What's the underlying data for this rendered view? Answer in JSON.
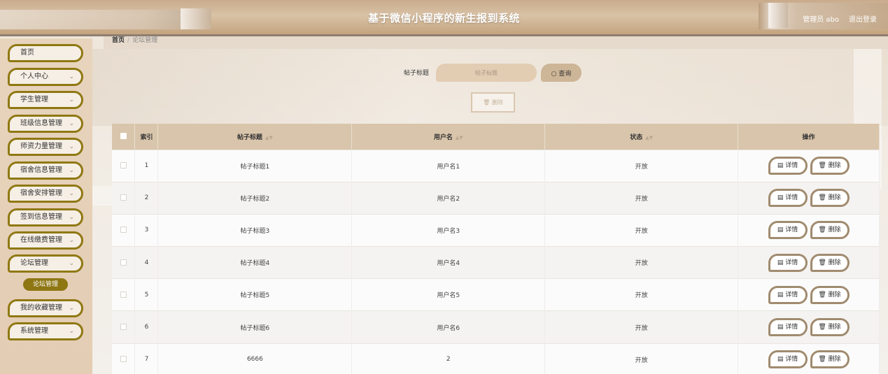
{
  "header": {
    "title": "基于微信小程序的新生报到系统",
    "admin_label": "管理员 abo",
    "logout": "退出登录"
  },
  "sidebar": {
    "items": [
      {
        "label": "首页",
        "chevron": false
      },
      {
        "label": "个人中心",
        "chevron": true
      },
      {
        "label": "学生管理",
        "chevron": true
      },
      {
        "label": "班级信息管理",
        "chevron": true
      },
      {
        "label": "师资力量管理",
        "chevron": true
      },
      {
        "label": "宿舍信息管理",
        "chevron": true
      },
      {
        "label": "宿舍安排管理",
        "chevron": true
      },
      {
        "label": "签到信息管理",
        "chevron": true
      },
      {
        "label": "在线缴费管理",
        "chevron": true
      },
      {
        "label": "论坛管理",
        "chevron": true
      },
      {
        "label": "我的收藏管理",
        "chevron": true
      },
      {
        "label": "系统管理",
        "chevron": true
      }
    ],
    "active_submenu": "论坛管理"
  },
  "breadcrumb": {
    "home": "首页",
    "separator": "/",
    "current": "论坛管理"
  },
  "search": {
    "label": "帖子标题",
    "placeholder": "帖子标题",
    "query_button": "查询",
    "delete_button": "删除"
  },
  "table": {
    "headers": {
      "index": "索引",
      "title": "帖子标题",
      "username": "用户名",
      "status": "状态",
      "actions": "操作"
    },
    "detail_label": "详情",
    "delete_label": "删除",
    "rows": [
      {
        "index": "1",
        "title": "帖子标题1",
        "username": "用户名1",
        "status": "开放"
      },
      {
        "index": "2",
        "title": "帖子标题2",
        "username": "用户名2",
        "status": "开放"
      },
      {
        "index": "3",
        "title": "帖子标题3",
        "username": "用户名3",
        "status": "开放"
      },
      {
        "index": "4",
        "title": "帖子标题4",
        "username": "用户名4",
        "status": "开放"
      },
      {
        "index": "5",
        "title": "帖子标题5",
        "username": "用户名5",
        "status": "开放"
      },
      {
        "index": "6",
        "title": "帖子标题6",
        "username": "用户名6",
        "status": "开放"
      },
      {
        "index": "7",
        "title": "6666",
        "username": "2",
        "status": "开放"
      }
    ]
  },
  "colors": {
    "accent": "#8f7812",
    "header_bg": "#c9ab8c",
    "table_header": "#d9c5ab"
  }
}
